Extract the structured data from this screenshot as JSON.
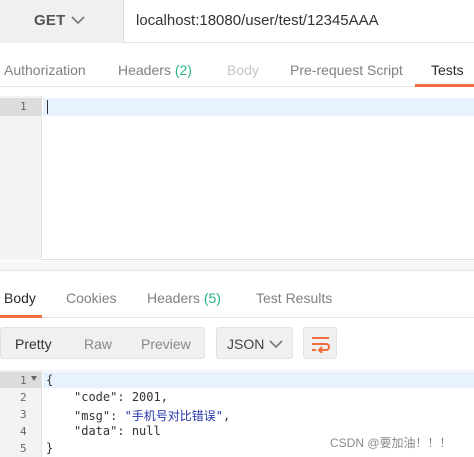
{
  "request": {
    "method": "GET",
    "url": "localhost:18080/user/test/12345AAA"
  },
  "request_tabs": {
    "authorization": "Authorization",
    "headers": "Headers",
    "headers_count": "(2)",
    "body": "Body",
    "pre_request": "Pre-request Script",
    "tests": "Tests",
    "active": "Tests"
  },
  "editor": {
    "line_numbers": [
      "1"
    ]
  },
  "response_tabs": {
    "body": "Body",
    "cookies": "Cookies",
    "headers": "Headers",
    "headers_count": "(5)",
    "test_results": "Test Results",
    "active": "Body"
  },
  "toolbar": {
    "pretty": "Pretty",
    "raw": "Raw",
    "preview": "Preview",
    "format": "JSON",
    "selected": "Pretty"
  },
  "response": {
    "line_numbers": [
      "1",
      "2",
      "3",
      "4",
      "5"
    ],
    "open_brace": "{",
    "code_key": "\"code\"",
    "code_value": "2001",
    "msg_key": "\"msg\"",
    "msg_value": "\"手机号对比错误\"",
    "data_key": "\"data\"",
    "data_value": "null",
    "close_brace": "}"
  },
  "watermark": "CSDN @要加油！！！",
  "colors": {
    "accent": "#f26b3a",
    "count": "#26b47f",
    "active_line": "#e8f2fe"
  }
}
